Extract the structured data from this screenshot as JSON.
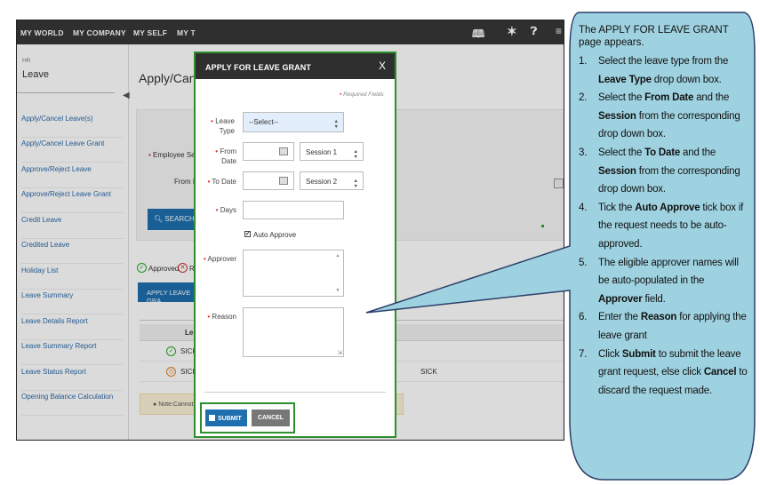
{
  "topnav": {
    "items": [
      "MY WORLD",
      "MY COMPANY",
      "MY SELF",
      "MY T"
    ],
    "icons": [
      "book-icon",
      "tools-icon",
      "help-icon",
      "menu-icon"
    ]
  },
  "sidebar": {
    "section": "HR",
    "module": "Leave",
    "items": [
      "Apply/Cancel Leave(s)",
      "Apply/Cancel Leave Grant",
      "Approve/Reject Leave",
      "Approve/Reject Leave Grant",
      "Credit Leave",
      "Credited Leave",
      "Holiday List",
      "Leave Summary",
      "Leave Details Report",
      "Leave Summary Report",
      "Leave Status Report",
      "Opening Balance Calculation"
    ]
  },
  "background": {
    "page_title": "Apply/Cance",
    "employee_label": "Employee Se",
    "from_label": "From D",
    "search_label": "SEARCH",
    "legend_approved": "Approved",
    "legend_rejected": "R",
    "apply_button": "APPLY LEAVE GRA",
    "col_header": "Le",
    "rows": [
      {
        "type": "SICK",
        "extra": ""
      },
      {
        "type": "SICK",
        "extra": "SICK"
      }
    ],
    "note": "Note:Cannot with"
  },
  "modal": {
    "title": "APPLY FOR LEAVE GRANT",
    "close": "X",
    "required_note": "Required Fields",
    "leave_type_label": "Leave Type",
    "leave_type_value": "--Select--",
    "from_date_label": "From Date",
    "from_session": "Session 1",
    "to_date_label": "To Date",
    "to_session": "Session 2",
    "days_label": "Days",
    "auto_approve_label": "Auto Approve",
    "auto_approve_checked": true,
    "approver_label": "Approver",
    "reason_label": "Reason",
    "submit_label": "SUBMIT",
    "cancel_label": "CANCEL"
  },
  "callout": {
    "intro": "The APPLY FOR LEAVE GRANT page appears.",
    "steps": [
      {
        "num": "1.",
        "parts": [
          [
            "Select the leave type from the ",
            false
          ],
          [
            "Leave Type",
            true
          ],
          [
            " drop down box.",
            false
          ]
        ]
      },
      {
        "num": "2.",
        "parts": [
          [
            "Select the ",
            false
          ],
          [
            "From Date",
            true
          ],
          [
            " and the ",
            false
          ],
          [
            "Session",
            true
          ],
          [
            " from the corresponding drop down box.",
            false
          ]
        ]
      },
      {
        "num": "3.",
        "parts": [
          [
            "Select the ",
            false
          ],
          [
            "To Date",
            true
          ],
          [
            " and the ",
            false
          ],
          [
            "Session",
            true
          ],
          [
            " from the corresponding drop down box.",
            false
          ]
        ]
      },
      {
        "num": "4.",
        "parts": [
          [
            "Tick the ",
            false
          ],
          [
            "Auto Approve",
            true
          ],
          [
            " tick box if the request needs to be auto-approved.",
            false
          ]
        ]
      },
      {
        "num": "5.",
        "parts": [
          [
            "The eligible approver names will be auto-populated in the ",
            false
          ],
          [
            "Approver",
            true
          ],
          [
            " field.",
            false
          ]
        ]
      },
      {
        "num": "6.",
        "parts": [
          [
            "Enter the ",
            false
          ],
          [
            "Reason",
            true
          ],
          [
            " for applying the leave grant",
            false
          ]
        ]
      },
      {
        "num": "7.",
        "parts": [
          [
            "Click ",
            false
          ],
          [
            "Submit",
            true
          ],
          [
            " to submit the leave grant request, else click ",
            false
          ],
          [
            "Cancel",
            true
          ],
          [
            " to discard the request made.",
            false
          ]
        ]
      }
    ]
  },
  "colors": {
    "navbar": "#2f2f2f",
    "accent": "#1e6fae",
    "highlight": "#2e8f2e",
    "callout_fill": "#9fd2e0",
    "callout_border": "#2a3f6a",
    "required": "#dd2222"
  }
}
